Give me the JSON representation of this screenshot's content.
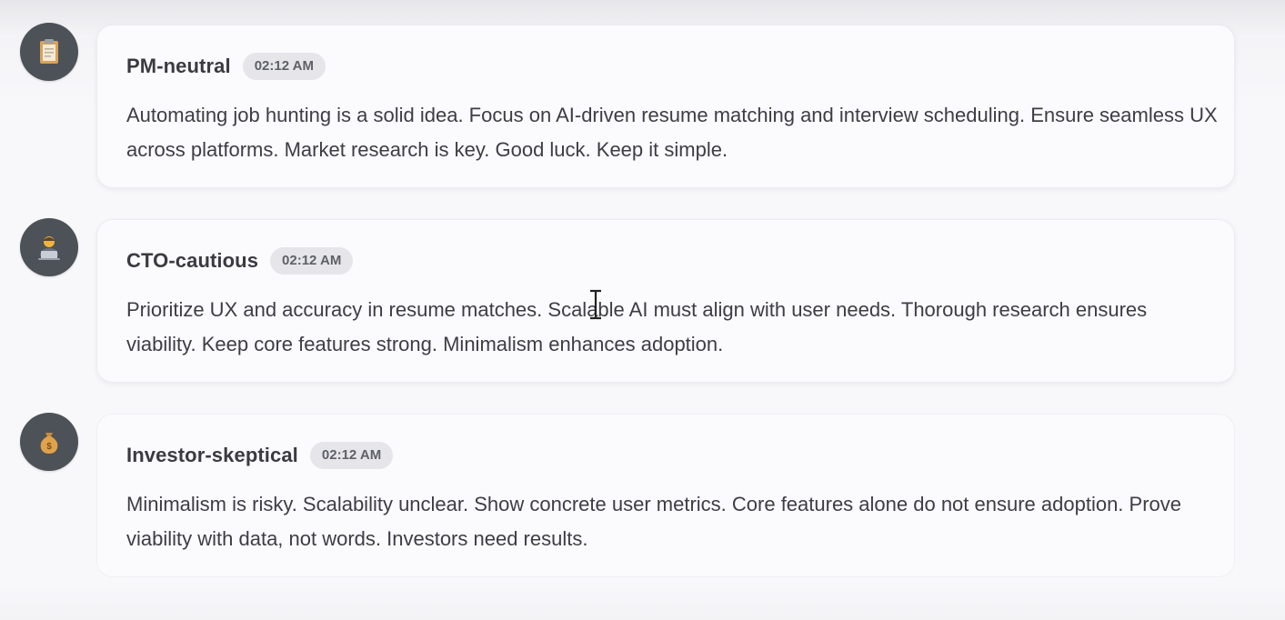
{
  "messages": [
    {
      "sender": "PM-neutral",
      "time": "02:12 AM",
      "avatar_icon": "clipboard-icon",
      "text": "Automating job hunting is a solid idea. Focus on AI-driven resume matching and interview scheduling. Ensure seamless UX across platforms. Market research is key. Good luck. Keep it simple."
    },
    {
      "sender": "CTO-cautious",
      "time": "02:12 AM",
      "avatar_icon": "technologist-icon",
      "text": "Prioritize UX and accuracy in resume matches. Scalable AI must align with user needs. Thorough research ensures viability. Keep core features strong. Minimalism enhances adoption."
    },
    {
      "sender": "Investor-skeptical",
      "time": "02:12 AM",
      "avatar_icon": "money-bag-icon",
      "text": "Minimalism is risky. Scalability unclear. Show concrete user metrics. Core features alone do not ensure adoption. Prove viability with data, not words. Investors need results."
    }
  ],
  "colors": {
    "avatar_bg": "#4d5158",
    "card_bg": "#fbfbfd",
    "badge_bg": "#e6e6ea",
    "text": "#3d3d44"
  }
}
